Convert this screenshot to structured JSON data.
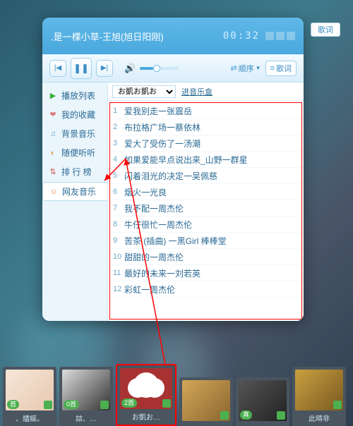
{
  "header": {
    "title": ".是一棵小草-王旭(旭日阳刚)",
    "time": "00:32"
  },
  "controls": {
    "mode": "顺序",
    "lyric_btn": "歌词"
  },
  "lyrics_ext": "歌词",
  "sidebar": {
    "items": [
      {
        "icon": "▶",
        "label": "播放列表",
        "color": "#3cae3c"
      },
      {
        "icon": "❤",
        "label": "我的收藏",
        "color": "#e07a7a"
      },
      {
        "icon": "♫",
        "label": "背景音乐",
        "color": "#6aa8e0"
      },
      {
        "icon": "◐",
        "label": "随便听听",
        "color": "#e0a050"
      },
      {
        "icon": "⇅",
        "label": "排 行 榜",
        "color": "#d05858"
      },
      {
        "icon": "☺",
        "label": "网友音乐",
        "color": "#e88a4a"
      }
    ]
  },
  "main": {
    "user_select": "お凱お凱お",
    "music_box_link": "进音乐盒",
    "tracks": [
      "爱我别走一张震岳",
      "布拉格广场一蔡依林",
      "爱大了受伤了一汤潮",
      "如果爱能早点说出来_山野一群星",
      "闪着泪光的决定一吴佩慈",
      "烟火一光良",
      "我不配一周杰伦",
      "牛仔很忙一周杰伦",
      "苦茶 (插曲) 一黑Girl 棒棒堂",
      "甜甜的一周杰伦",
      "最好的未来一刘若英",
      "彩虹一周杰伦"
    ]
  },
  "dock": {
    "items": [
      {
        "label": "、燼娫。",
        "badge": "首",
        "thumb": "woman"
      },
      {
        "label": "誩、…",
        "badge": "0首",
        "thumb": "bw"
      },
      {
        "label": "お凱お…",
        "badge": "2首",
        "thumb": "dog",
        "selected": true
      },
      {
        "label": "",
        "badge": "",
        "thumb": "anime"
      },
      {
        "label": "",
        "badge": "真",
        "thumb": "dark"
      },
      {
        "label": "此晴非",
        "badge": "",
        "thumb": "gold"
      }
    ]
  }
}
